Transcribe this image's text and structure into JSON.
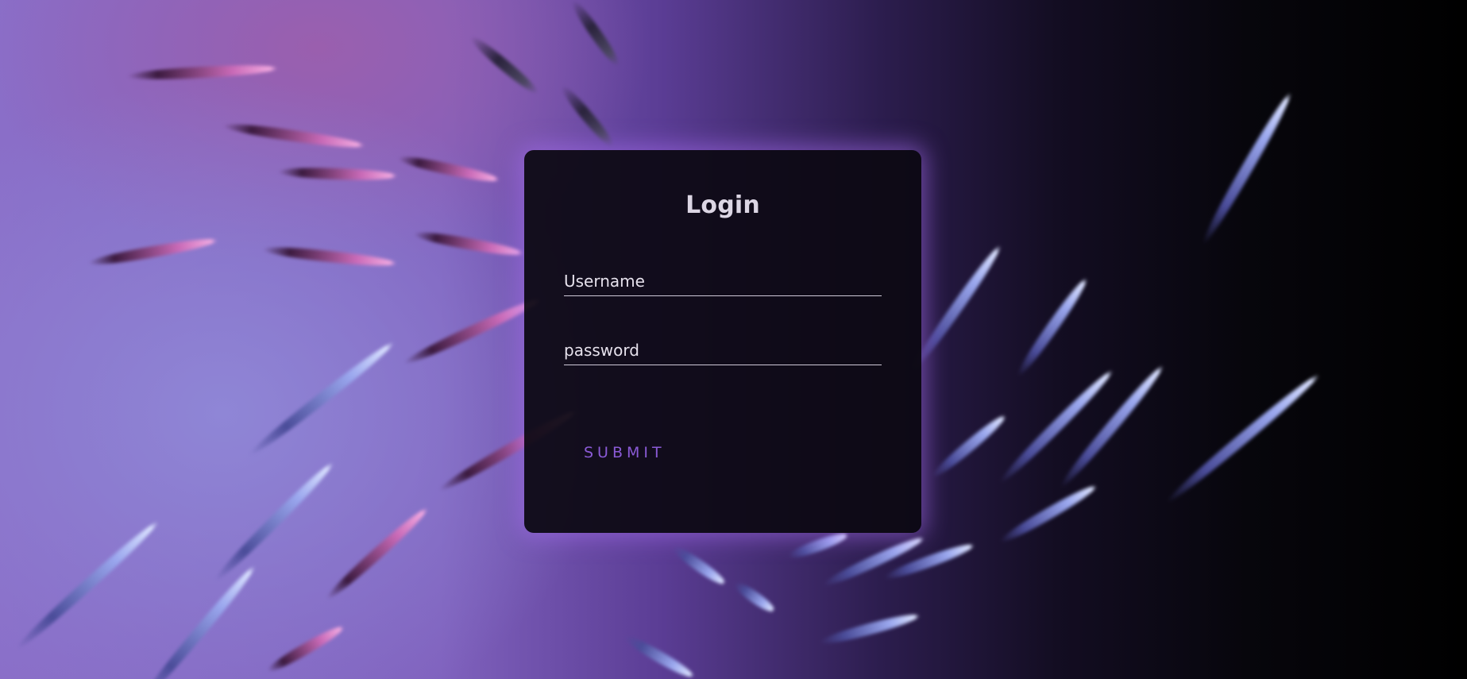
{
  "login": {
    "title": "Login",
    "username": {
      "label": "Username",
      "value": ""
    },
    "password": {
      "label": "password",
      "value": ""
    },
    "submit_label": "SUBMIT"
  },
  "colors": {
    "accent": "#8a5ad6",
    "glow": "#a86ef0",
    "panel": "#0c0912",
    "text": "#dcd6e4"
  }
}
